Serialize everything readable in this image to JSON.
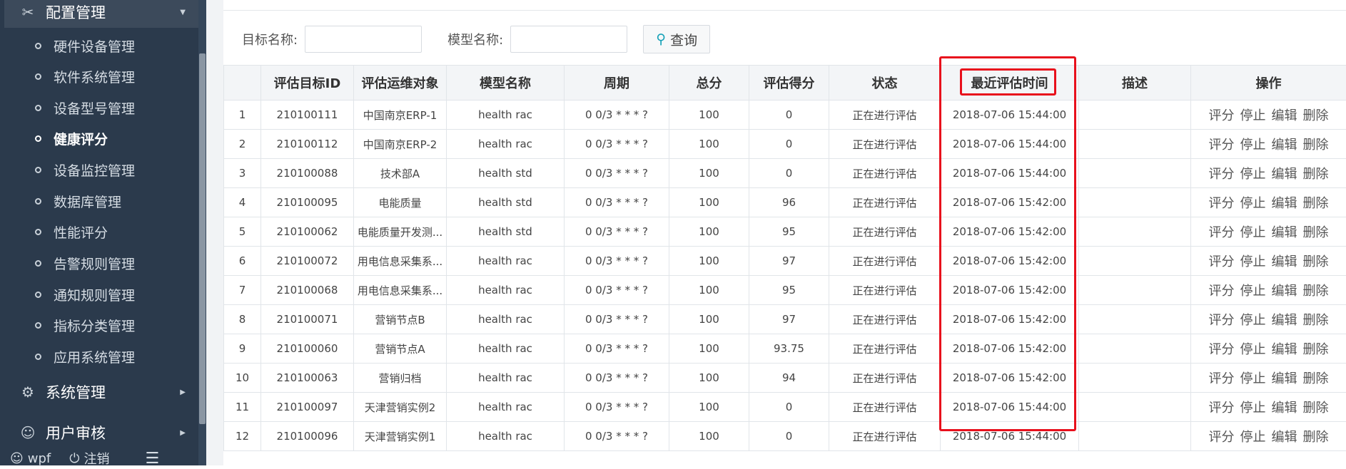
{
  "sidebar": {
    "group_config": {
      "label": "配置管理",
      "icon": "wrench-icon"
    },
    "items": [
      {
        "label": "硬件设备管理"
      },
      {
        "label": "软件系统管理"
      },
      {
        "label": "设备型号管理"
      },
      {
        "label": "健康评分"
      },
      {
        "label": "设备监控管理"
      },
      {
        "label": "数据库管理"
      },
      {
        "label": "性能评分"
      },
      {
        "label": "告警规则管理"
      },
      {
        "label": "通知规则管理"
      },
      {
        "label": "指标分类管理"
      },
      {
        "label": "应用系统管理"
      }
    ],
    "group_system": {
      "label": "系统管理",
      "icon": "gear-icon"
    },
    "group_audit": {
      "label": "用户审核",
      "icon": "users-icon"
    },
    "footer": {
      "user": "wpf",
      "logout": "注销"
    }
  },
  "search": {
    "target_label": "目标名称:",
    "model_label": "模型名称:",
    "query_button": "查询"
  },
  "table": {
    "headers": [
      "",
      "评估目标ID",
      "评估运维对象",
      "模型名称",
      "周期",
      "总分",
      "评估得分",
      "状态",
      "最近评估时间",
      "描述",
      "操作"
    ],
    "rows": [
      [
        "1",
        "210100111",
        "中国南京ERP-1",
        "health rac",
        "0 0/3 * * * ?",
        "100",
        "0",
        "正在进行评估",
        "2018-07-06 15:44:00",
        ""
      ],
      [
        "2",
        "210100112",
        "中国南京ERP-2",
        "health rac",
        "0 0/3 * * * ?",
        "100",
        "0",
        "正在进行评估",
        "2018-07-06 15:44:00",
        ""
      ],
      [
        "3",
        "210100088",
        "技术部A",
        "health std",
        "0 0/3 * * * ?",
        "100",
        "0",
        "正在进行评估",
        "2018-07-06 15:44:00",
        ""
      ],
      [
        "4",
        "210100095",
        "电能质量",
        "health std",
        "0 0/3 * * * ?",
        "100",
        "96",
        "正在进行评估",
        "2018-07-06 15:42:00",
        ""
      ],
      [
        "5",
        "210100062",
        "电能质量开发测...",
        "health std",
        "0 0/3 * * * ?",
        "100",
        "95",
        "正在进行评估",
        "2018-07-06 15:42:00",
        ""
      ],
      [
        "6",
        "210100072",
        "用电信息采集系...",
        "health rac",
        "0 0/3 * * * ?",
        "100",
        "97",
        "正在进行评估",
        "2018-07-06 15:42:00",
        ""
      ],
      [
        "7",
        "210100068",
        "用电信息采集系...",
        "health rac",
        "0 0/3 * * * ?",
        "100",
        "95",
        "正在进行评估",
        "2018-07-06 15:42:00",
        ""
      ],
      [
        "8",
        "210100071",
        "营销节点B",
        "health rac",
        "0 0/3 * * * ?",
        "100",
        "97",
        "正在进行评估",
        "2018-07-06 15:42:00",
        ""
      ],
      [
        "9",
        "210100060",
        "营销节点A",
        "health rac",
        "0 0/3 * * * ?",
        "100",
        "93.75",
        "正在进行评估",
        "2018-07-06 15:42:00",
        ""
      ],
      [
        "10",
        "210100063",
        "营销归档",
        "health rac",
        "0 0/3 * * * ?",
        "100",
        "94",
        "正在进行评估",
        "2018-07-06 15:42:00",
        ""
      ],
      [
        "11",
        "210100097",
        "天津营销实例2",
        "health rac",
        "0 0/3 * * * ?",
        "100",
        "0",
        "正在进行评估",
        "2018-07-06 15:44:00",
        ""
      ],
      [
        "12",
        "210100096",
        "天津营销实例1",
        "health rac",
        "0 0/3 * * * ?",
        "100",
        "0",
        "正在进行评估",
        "2018-07-06 15:44:00",
        ""
      ]
    ],
    "actions": [
      "评分",
      "停止",
      "编辑",
      "删除"
    ]
  },
  "colors": {
    "sidebar_bg": "#2b3a4c",
    "highlight": "#e8101c",
    "accent": "#17a2b8"
  }
}
